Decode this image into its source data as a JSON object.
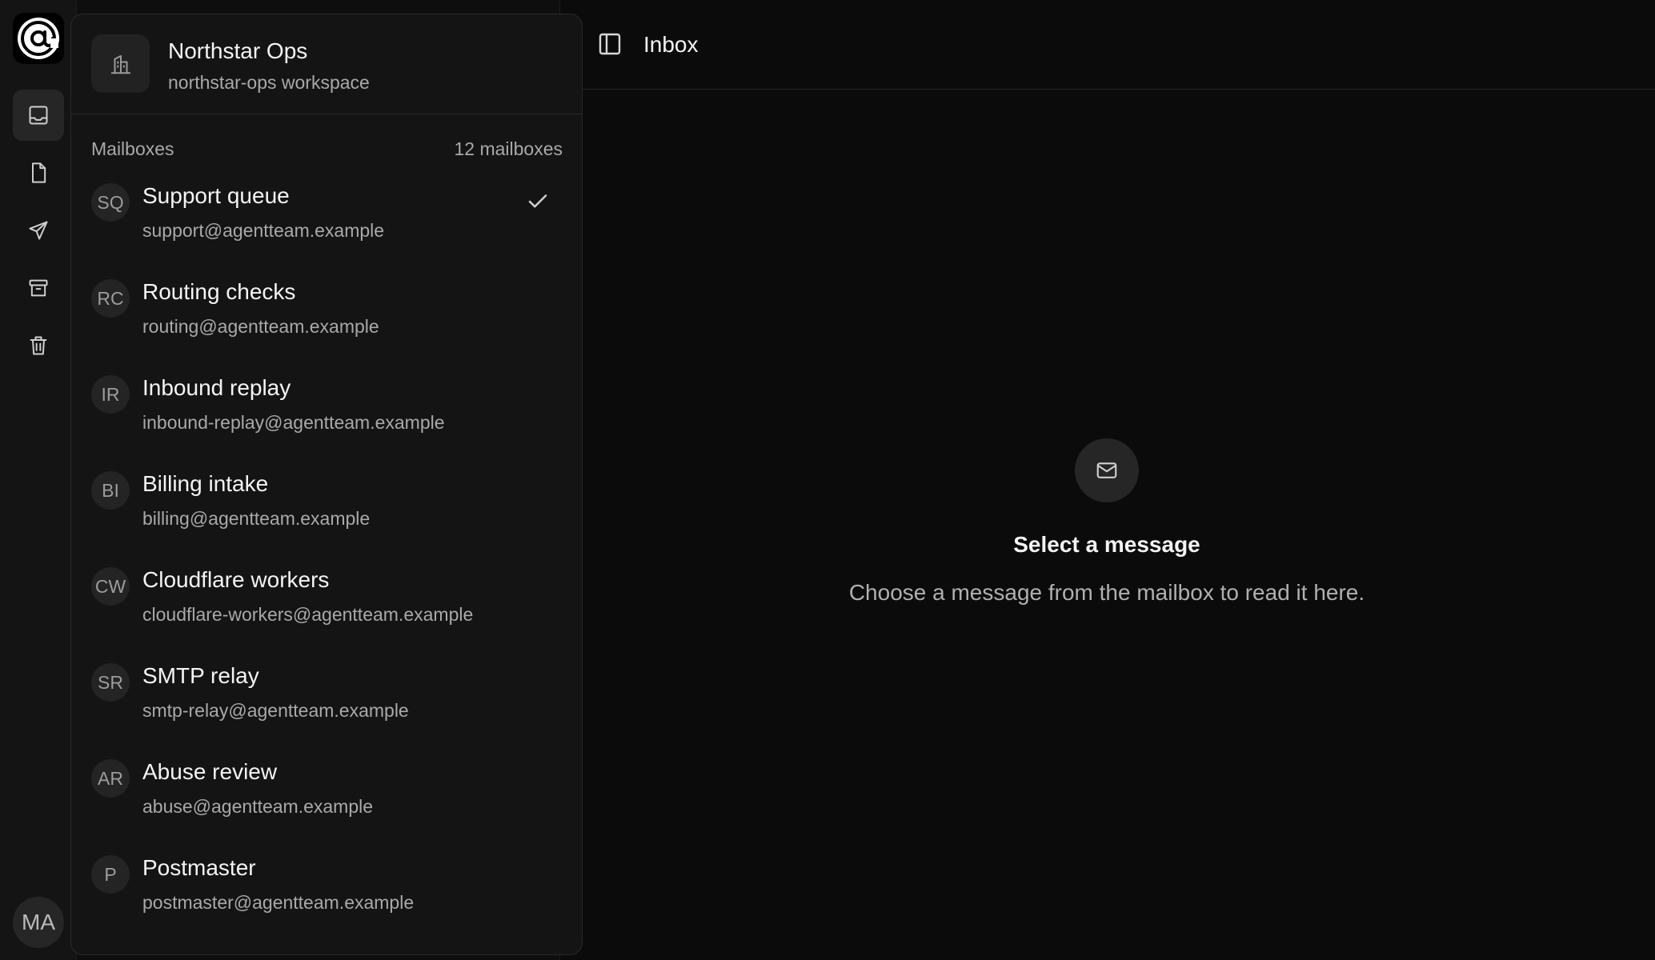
{
  "topbar": {
    "title": "Inbox"
  },
  "workspace": {
    "name": "Northstar Ops",
    "subtitle": "northstar-ops workspace"
  },
  "mailboxes": {
    "label": "Mailboxes",
    "count": "12 mailboxes",
    "items": [
      {
        "initials": "SQ",
        "name": "Support queue",
        "email": "support@agentteam.example",
        "selected": true
      },
      {
        "initials": "RC",
        "name": "Routing checks",
        "email": "routing@agentteam.example",
        "selected": false
      },
      {
        "initials": "IR",
        "name": "Inbound replay",
        "email": "inbound-replay@agentteam.example",
        "selected": false
      },
      {
        "initials": "BI",
        "name": "Billing intake",
        "email": "billing@agentteam.example",
        "selected": false
      },
      {
        "initials": "CW",
        "name": "Cloudflare workers",
        "email": "cloudflare-workers@agentteam.example",
        "selected": false
      },
      {
        "initials": "SR",
        "name": "SMTP relay",
        "email": "smtp-relay@agentteam.example",
        "selected": false
      },
      {
        "initials": "AR",
        "name": "Abuse review",
        "email": "abuse@agentteam.example",
        "selected": false
      },
      {
        "initials": "P",
        "name": "Postmaster",
        "email": "postmaster@agentteam.example",
        "selected": false
      }
    ]
  },
  "rail": {
    "nav": [
      {
        "icon": "inbox-icon",
        "active": true
      },
      {
        "icon": "file-icon",
        "active": false
      },
      {
        "icon": "send-icon",
        "active": false
      },
      {
        "icon": "archive-icon",
        "active": false
      },
      {
        "icon": "trash-icon",
        "active": false
      }
    ],
    "user_initials": "MA"
  },
  "empty_state": {
    "title": "Select a message",
    "description": "Choose a message from the mailbox to read it here."
  }
}
